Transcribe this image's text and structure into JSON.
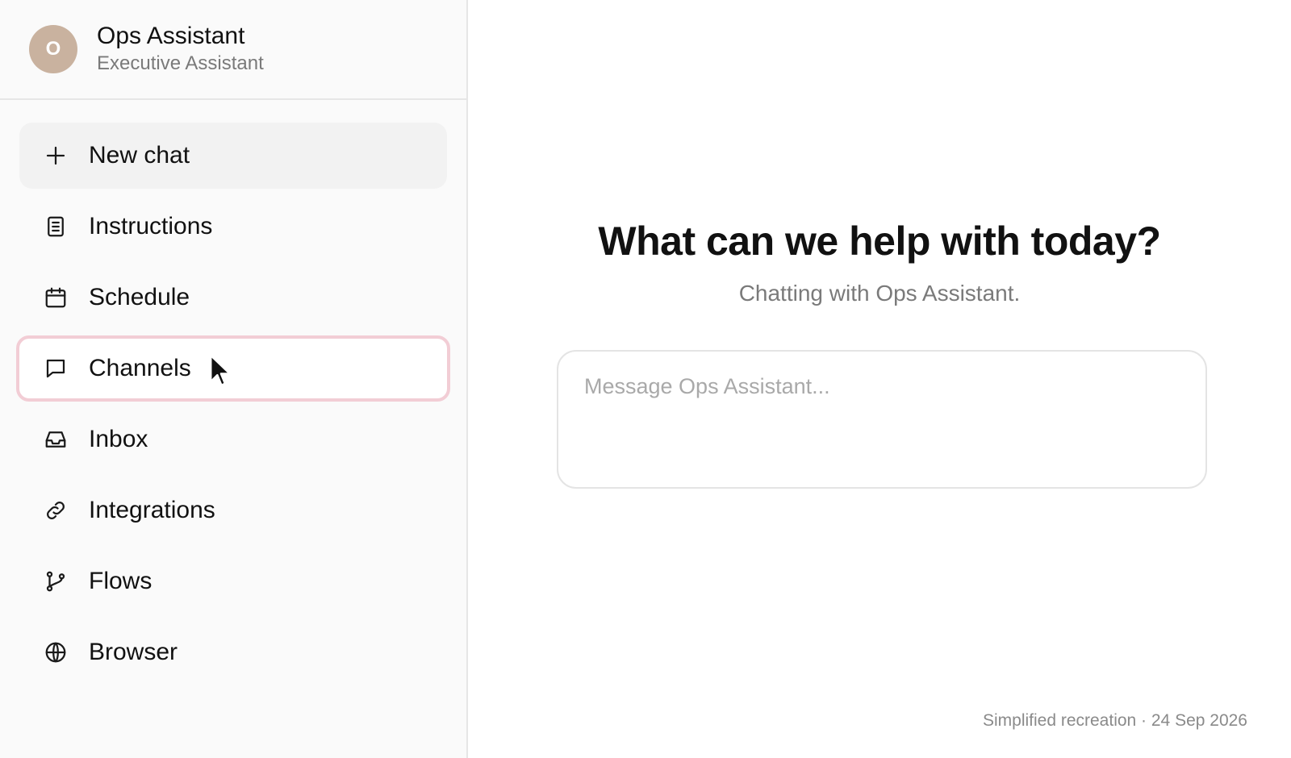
{
  "profile": {
    "avatar_initial": "O",
    "name": "Ops Assistant",
    "role": "Executive Assistant",
    "avatar_color": "#c9b29f"
  },
  "sidebar": {
    "items": [
      {
        "label": "New chat",
        "icon": "plus-icon"
      },
      {
        "label": "Instructions",
        "icon": "document-icon"
      },
      {
        "label": "Schedule",
        "icon": "calendar-icon"
      },
      {
        "label": "Channels",
        "icon": "chat-bubble-icon",
        "selected": true
      },
      {
        "label": "Inbox",
        "icon": "inbox-icon"
      },
      {
        "label": "Integrations",
        "icon": "link-icon"
      },
      {
        "label": "Flows",
        "icon": "branch-icon"
      },
      {
        "label": "Browser",
        "icon": "globe-icon"
      }
    ],
    "selected_border_color": "#f2cdd5"
  },
  "main": {
    "headline": "What can we help with today?",
    "subtitle": "Chatting with Ops Assistant.",
    "composer": {
      "placeholder": "Message Ops Assistant...",
      "value": ""
    },
    "footer_note": "Simplified recreation · 24 Sep 2026"
  }
}
